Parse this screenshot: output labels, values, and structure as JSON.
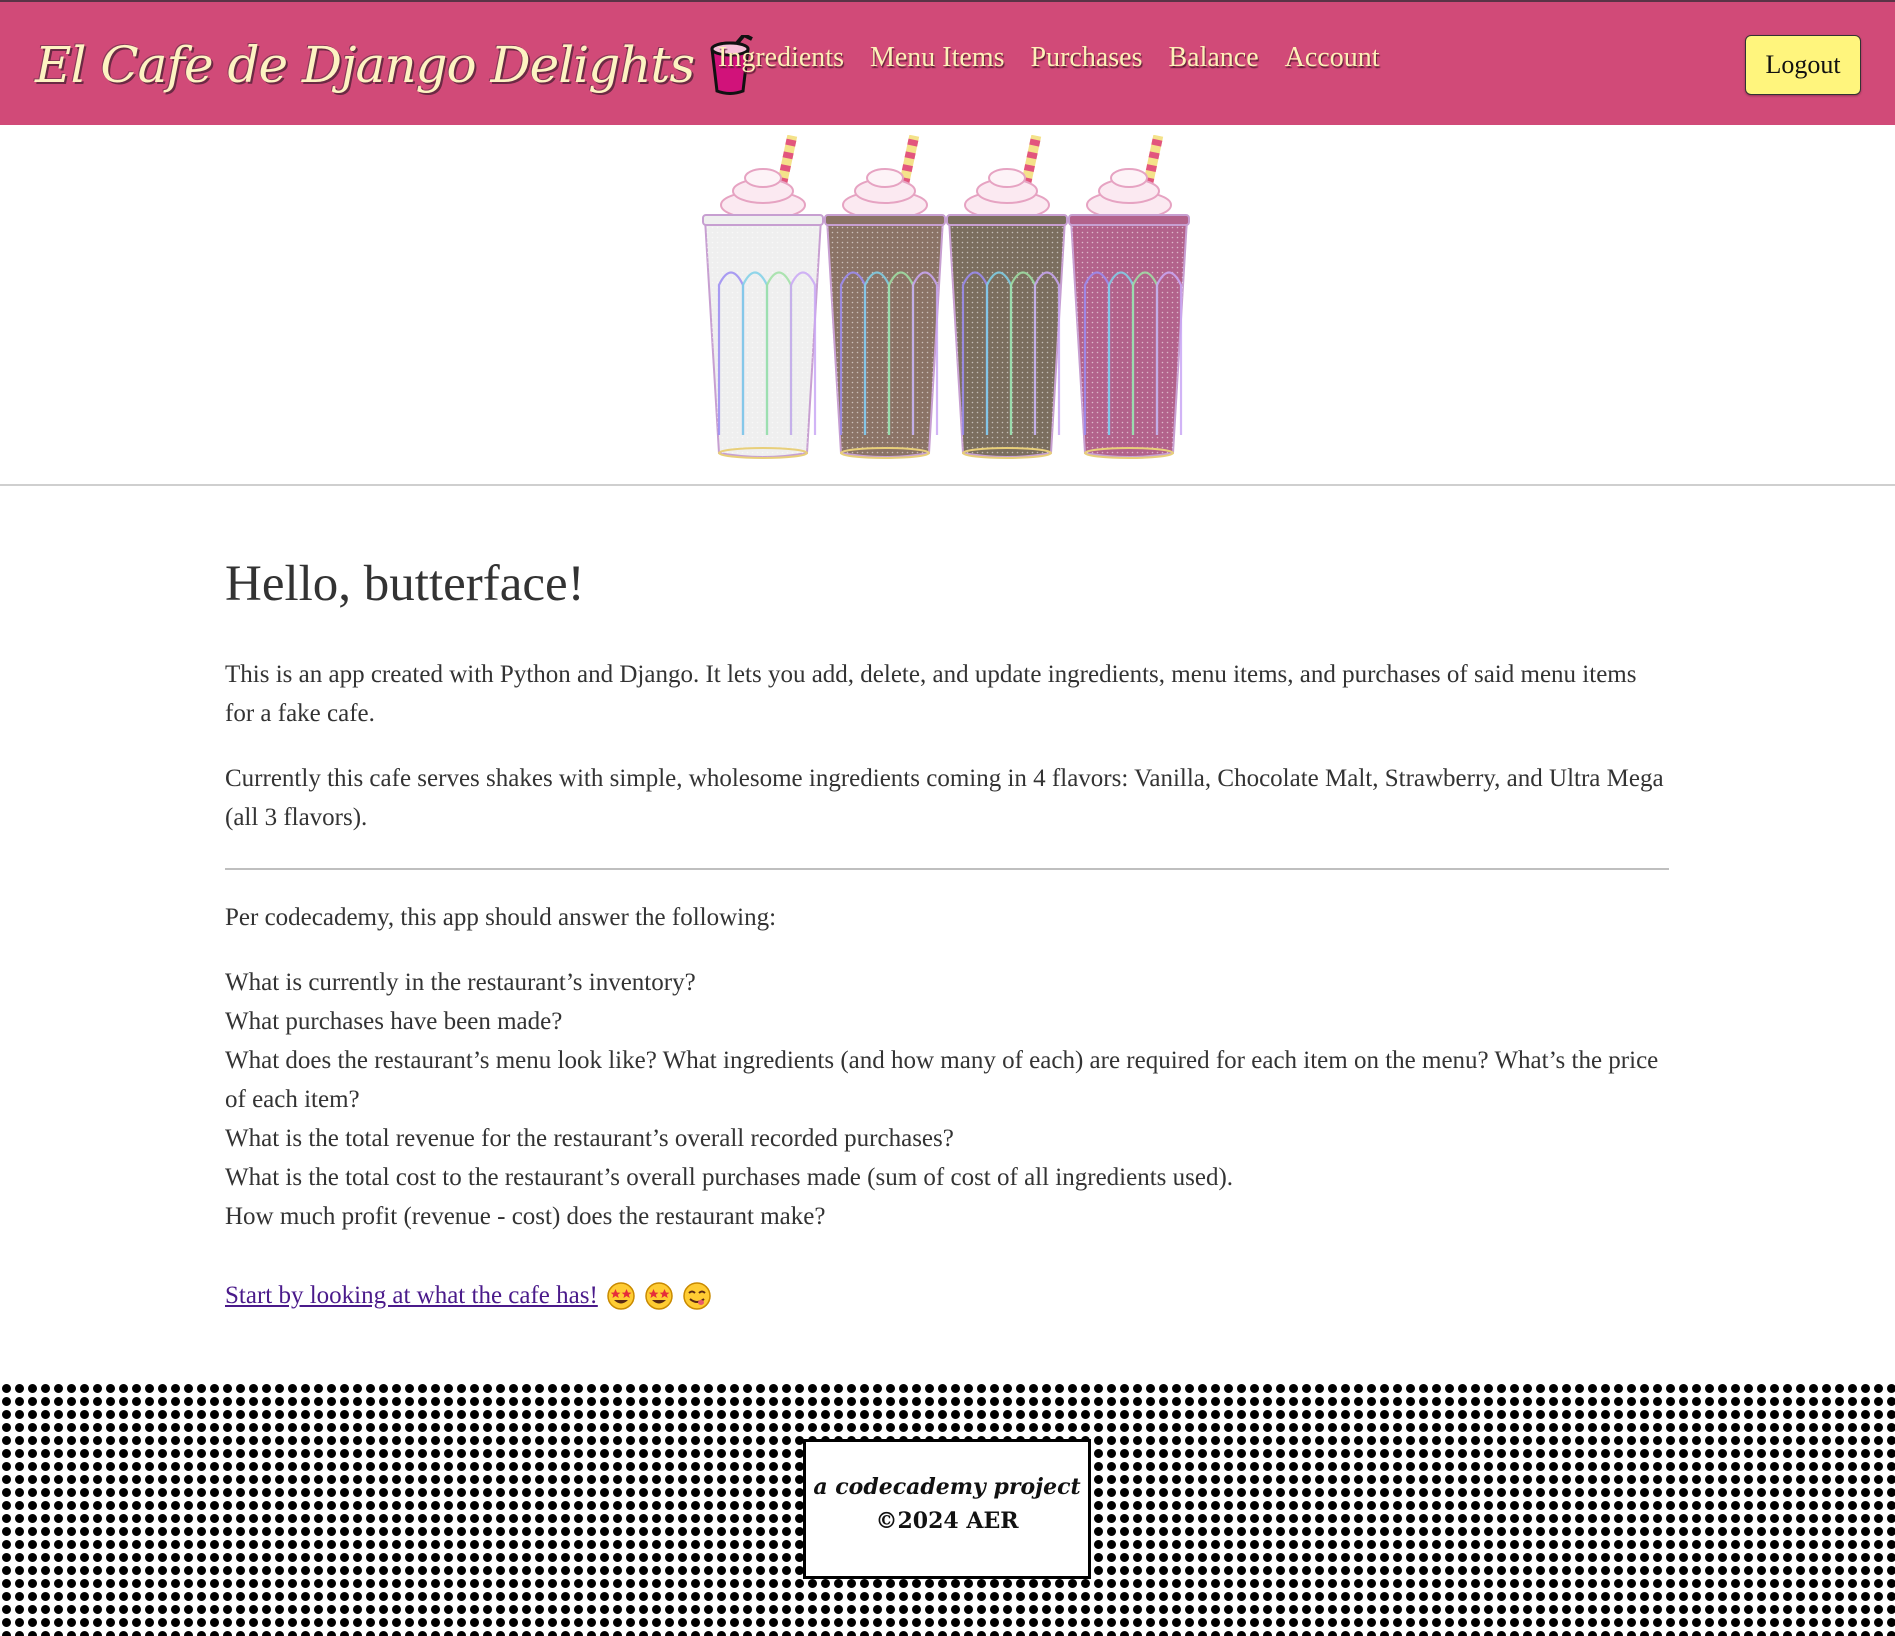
{
  "header": {
    "brand_title": "El Cafe de Django Delights",
    "nav_links": [
      "Ingredients",
      "Menu Items",
      "Purchases",
      "Balance",
      "Account"
    ],
    "logout_label": "Logout",
    "accent_color": "#d14a78",
    "button_color": "#fff57d"
  },
  "hero": {
    "shakes": [
      {
        "flavor": "Vanilla",
        "color": "#efefef"
      },
      {
        "flavor": "Strawberry-Chocolate",
        "color": "#8b7366"
      },
      {
        "flavor": "Chocolate Malt",
        "color": "#7b6e5e"
      },
      {
        "flavor": "Strawberry",
        "color": "#b2628b"
      }
    ]
  },
  "main": {
    "greeting": "Hello, butterface!",
    "intro_paragraph": "This is an app created with Python and Django. It lets you add, delete, and update ingredients, menu items, and purchases of said menu items for a fake cafe.",
    "flavors_paragraph": "Currently this cafe serves shakes with simple, wholesome ingredients coming in 4 flavors: Vanilla, Chocolate Malt, Strawberry, and Ultra Mega (all 3 flavors).",
    "requirements_intro": "Per codecademy, this app should answer the following:",
    "questions": [
      "What is currently in the restaurant’s inventory?",
      "What purchases have been made?",
      "What does the restaurant’s menu look like? What ingredients (and how many of each) are required for each item on the menu? What’s the price of each item?",
      "What is the total revenue for the restaurant’s overall recorded purchases?",
      "What is the total cost to the restaurant’s overall purchases made (sum of cost of all ingredients used).",
      "How much profit (revenue - cost) does the restaurant make?"
    ],
    "cta_link": "Start by looking at what the cafe has!",
    "cta_emojis": [
      "star-struck-emoji-icon",
      "star-struck-emoji-icon",
      "yum-emoji-icon"
    ]
  },
  "footer": {
    "line1": "a codecademy project",
    "line2": "©2024 AER"
  }
}
